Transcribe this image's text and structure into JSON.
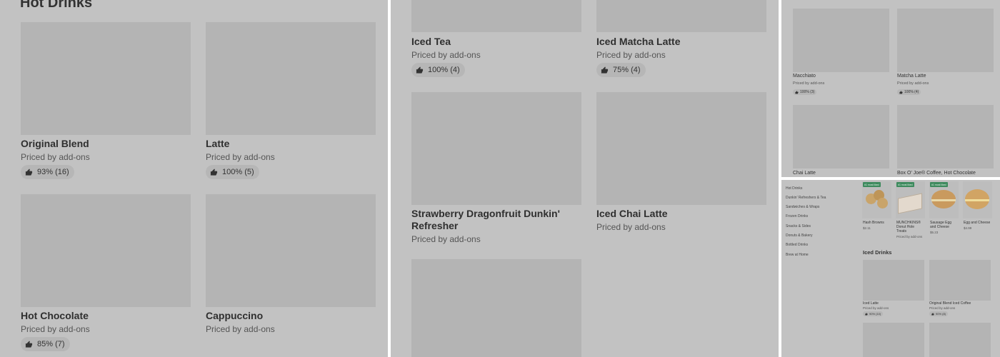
{
  "panel_a": {
    "section_title": "Hot Drinks",
    "items": [
      {
        "name": "Original Blend",
        "subtitle": "Priced by add-ons",
        "rating": "93% (16)"
      },
      {
        "name": "Latte",
        "subtitle": "Priced by add-ons",
        "rating": "100% (5)"
      },
      {
        "name": "Hot Chocolate",
        "subtitle": "Priced by add-ons",
        "rating": "85% (7)"
      },
      {
        "name": "Cappuccino",
        "subtitle": "Priced by add-ons",
        "rating": ""
      }
    ]
  },
  "panel_b": {
    "items": [
      {
        "name": "Iced Tea",
        "subtitle": "Priced by add-ons",
        "rating": "100% (4)"
      },
      {
        "name": "Iced Matcha Latte",
        "subtitle": "Priced by add-ons",
        "rating": "75% (4)"
      },
      {
        "name": "Strawberry Dragonfruit Dunkin' Refresher",
        "subtitle": "Priced by add-ons",
        "rating": ""
      },
      {
        "name": "Iced Chai Latte",
        "subtitle": "Priced by add-ons",
        "rating": ""
      }
    ]
  },
  "panel_c": {
    "items": [
      {
        "name": "Macchiato",
        "subtitle": "Priced by add-ons",
        "rating": "100% (3)"
      },
      {
        "name": "Matcha Latte",
        "subtitle": "Priced by add-ons",
        "rating": "100% (4)"
      },
      {
        "name": "Chai Latte"
      },
      {
        "name": "Box O' Joe® Coffee, Hot Chocolate"
      }
    ]
  },
  "panel_d": {
    "nav": [
      "Hot Drinks",
      "Dunkin' Refreshers & Tea",
      "Sandwiches & Wraps",
      "Frozen Drinks",
      "Snacks & Sides",
      "Donuts & Bakery",
      "Bottled Drinks",
      "Brew at Home"
    ],
    "badge_label": "#1 most liked",
    "featured": [
      {
        "name": "Hash Browns",
        "price": "$2.11",
        "badge": true
      },
      {
        "name": "MUNCHKINS® Donut Hole Treats",
        "price": "Priced by add-ons",
        "badge": true
      },
      {
        "name": "Sausage Egg and Cheese",
        "price": "$5.23",
        "badge": true
      },
      {
        "name": "Egg and Cheese",
        "price": "$4.99",
        "badge": false
      }
    ],
    "section_title": "Iced Drinks",
    "items": [
      {
        "name": "Iced Latte",
        "subtitle": "Priced by add-ons",
        "rating": "90% (10)"
      },
      {
        "name": "Original Blend Iced Coffee",
        "subtitle": "Priced by add-ons",
        "rating": "90% (8)"
      }
    ],
    "colors": {
      "badge": "#3d8a5d",
      "food": "#c9a46a"
    }
  }
}
